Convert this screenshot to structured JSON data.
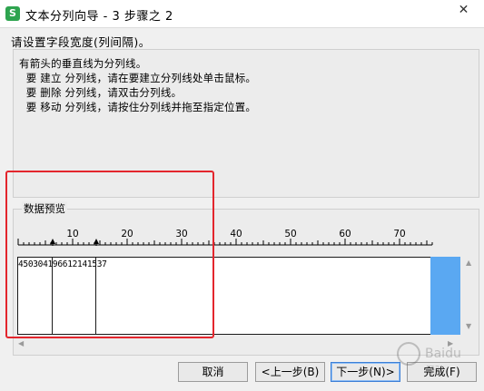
{
  "window": {
    "title": "文本分列向导 - 3 步骤之 2",
    "app_icon_label": "S",
    "close_glyph": "✕"
  },
  "instruction": "请设置字段宽度(列间隔)。",
  "info": {
    "lines": [
      "有箭头的垂直线为分列线。",
      "  要 建立 分列线，请在要建立分列线处单击鼠标。",
      "  要 删除 分列线，请双击分列线。",
      "  要 移动 分列线，请按住分列线并拖至指定位置。"
    ]
  },
  "preview": {
    "label": "数据预览",
    "ruler_labels": [
      "10",
      "20",
      "30",
      "40",
      "50",
      "60",
      "70"
    ],
    "data_text": "450304196612141537",
    "break_positions": [
      6,
      14
    ]
  },
  "buttons": {
    "cancel": "取消",
    "back": "<上一步(B)",
    "next": "下一步(N)>",
    "finish": "完成(F)"
  },
  "colors": {
    "accent_blue": "#5aa8f2",
    "highlight_red": "#e3262d",
    "app_icon_green": "#2ea44f"
  },
  "watermark": "Baidu 经验"
}
